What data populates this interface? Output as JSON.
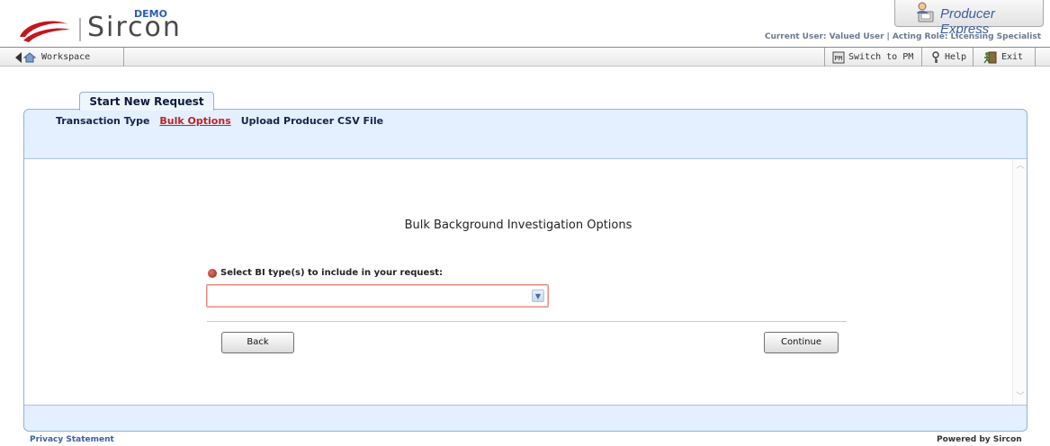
{
  "brand": {
    "name": "Sircon",
    "edition": "DEMO",
    "product": "Producer Express"
  },
  "session": {
    "user": "Current User: Valued User",
    "role": "Acting Role: Licensing Specialist",
    "separator": "|"
  },
  "toolbar": {
    "workspace": "Workspace",
    "switch_pm": "Switch to PM",
    "help": "Help",
    "exit": "Exit"
  },
  "tab": {
    "label": "Start New Request"
  },
  "steps": [
    {
      "label": "Transaction Type",
      "active": false
    },
    {
      "label": "Bulk Options",
      "active": true
    },
    {
      "label": "Upload Producer CSV File",
      "active": false
    }
  ],
  "form": {
    "heading": "Bulk Background Investigation Options",
    "bi_type_label": "Select BI type(s) to include in your request:",
    "bi_type_value": ""
  },
  "buttons": {
    "back": "Back",
    "continue": "Continue"
  },
  "footer": {
    "privacy": "Privacy Statement",
    "powered_by": "Powered by  Sircon"
  },
  "colors": {
    "accent_red": "#c22121",
    "panel_blue": "#e4efff",
    "panel_border": "#8fb2d8",
    "link_blue": "#3b5fa7"
  }
}
